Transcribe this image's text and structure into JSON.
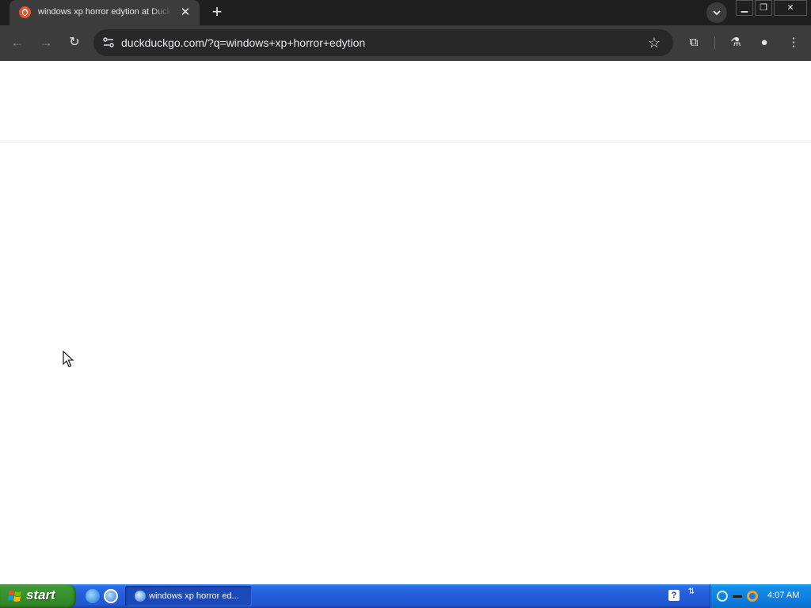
{
  "browser": {
    "tab": {
      "title": "windows xp horror edytion at DuckDuckGo",
      "close_label": "✕"
    },
    "new_tab_label": "+",
    "window_controls": {
      "minimize": "▁",
      "maximize": "❐",
      "close": "✕"
    },
    "toolbar": {
      "back_label": "←",
      "forward_label": "→",
      "reload_label": "↻",
      "url": "duckduckgo.com/?q=windows+xp+horror+edytion",
      "bookmark_label": "☆",
      "extensions_label": "⧉",
      "labs_label": "⚗",
      "profile_label": "●",
      "menu_label": "⋮"
    }
  },
  "taskbar": {
    "start_label": "start",
    "quick_launch": [
      "internet-explorer-icon",
      "ie-alt-icon"
    ],
    "task": {
      "label": "windows xp horror ed..."
    },
    "help_label": "?",
    "clock": "4:07 AM"
  },
  "colors": {
    "tabstrip": "#1f1f1f",
    "toolbar": "#3c3c3c",
    "omnibox": "#282828",
    "taskbar_blue": "#245edb",
    "start_green": "#3c9a31",
    "tray_blue": "#0f7fe0",
    "duckduckgo_orange": "#de5833"
  }
}
